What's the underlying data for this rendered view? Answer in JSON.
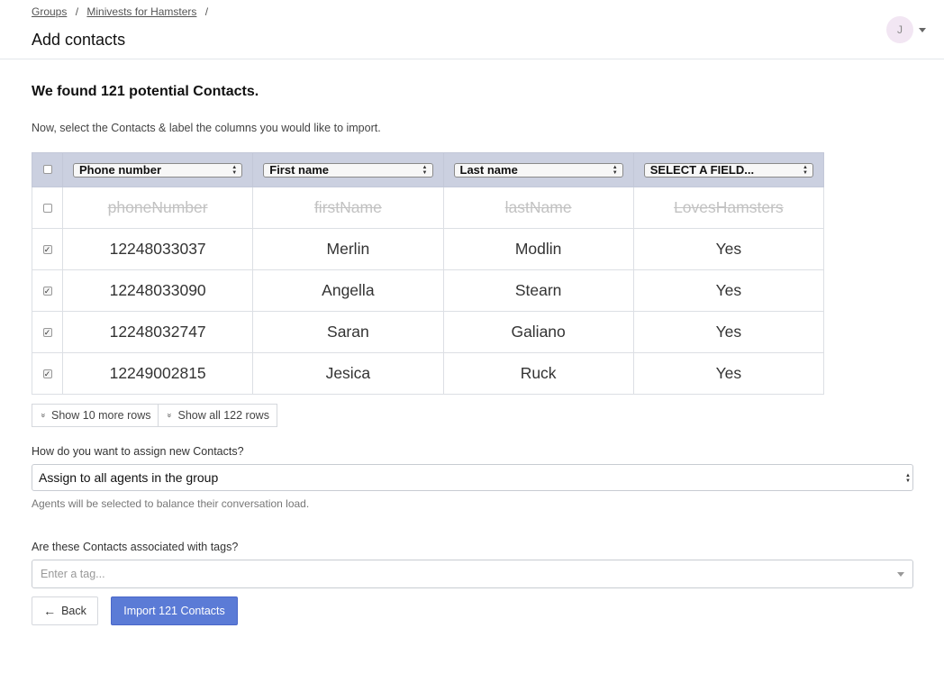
{
  "breadcrumb": [
    "Groups",
    "Minivests for Hamsters"
  ],
  "breadcrumb_separator": "/",
  "page_title": "Add contacts",
  "user": {
    "initial": "J",
    "avatar_color": "#f2e6f3"
  },
  "found_title": "We found 121 potential Contacts.",
  "instructions": "Now, select the Contacts & label the columns you would like to import.",
  "table": {
    "column_selects": [
      "Phone number",
      "First name",
      "Last name",
      "SELECT A FIELD..."
    ],
    "header_row": {
      "checked": false,
      "cells": [
        "phoneNumber",
        "firstName",
        "lastName",
        "LovesHamsters"
      ]
    },
    "rows": [
      {
        "checked": true,
        "cells": [
          "12248033037",
          "Merlin",
          "Modlin",
          "Yes"
        ]
      },
      {
        "checked": true,
        "cells": [
          "12248033090",
          "Angella",
          "Stearn",
          "Yes"
        ]
      },
      {
        "checked": true,
        "cells": [
          "12248032747",
          "Saran",
          "Galiano",
          "Yes"
        ]
      },
      {
        "checked": true,
        "cells": [
          "12249002815",
          "Jesica",
          "Ruck",
          "Yes"
        ]
      }
    ]
  },
  "show_more_label": "Show 10 more rows",
  "show_all_label": "Show all 122 rows",
  "assign": {
    "label": "How do you want to assign new Contacts?",
    "value": "Assign to all agents in the group",
    "help": "Agents will be selected to balance their conversation load."
  },
  "tags": {
    "label": "Are these Contacts associated with tags?",
    "placeholder": "Enter a tag..."
  },
  "back_label": "Back",
  "import_label": "Import 121 Contacts",
  "colors": {
    "primary": "#5b7bd6",
    "table_header": "#cbd0e0"
  }
}
